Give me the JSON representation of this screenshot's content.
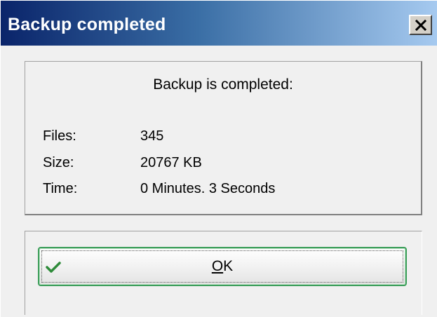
{
  "window": {
    "title": "Backup completed",
    "close_label": "×"
  },
  "panel": {
    "heading": "Backup is completed:",
    "rows": [
      {
        "label": "Files:",
        "value": "345"
      },
      {
        "label": "Size:",
        "value": "20767 KB"
      },
      {
        "label": "Time:",
        "value": "0 Minutes. 3 Seconds"
      }
    ]
  },
  "ok_button": {
    "mnemonic": "O",
    "rest": "K"
  },
  "colors": {
    "title_gradient_start": "#0a246a",
    "title_gradient_end": "#a6caf0",
    "ok_border": "#3c9e5a",
    "check_color": "#2e8b3a"
  },
  "icons": {
    "close": "close-icon",
    "ok": "checkmark-icon"
  }
}
